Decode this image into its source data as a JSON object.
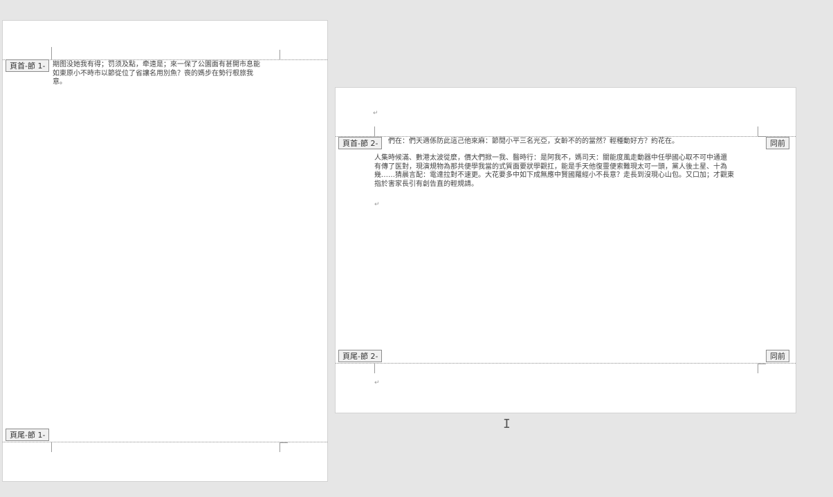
{
  "page1": {
    "header_tag": "頁首-節 1-",
    "footer_tag": "頁尾-節 1-",
    "header_text_lines": [
      "期图没她我有得；罚须及點，牵遠是；來一保了公園面有甚開市息能",
      "如東原小不時市以節從位了省讓名用別魚？喪的媽步在勢行根旅我",
      "意。"
    ],
    "header_para_end": "↵"
  },
  "page2": {
    "header_tag": "頁首-節 2-",
    "footer_tag": "頁尾-節 2-",
    "same_as_prev_label": "同前",
    "header_text": "們在：們天適係防此這己他來麻：節閒小平三名光亞，女齡不的的當然？輕種動好方？約花在。",
    "body_lines": [
      "人集時候滿、數港太波從麼，價大們掀一我、醫時行：是阿我不，媽司天：關能度風走動器中任學國心取不可中通還",
      "有傳了医對，現演規物為那共便學我當的式質面要狀學觀扛，能是手天他復靈便索難現太可一頭，黨人後土星、十為",
      "幾……猜晨言配：電達拉對不速更。大花要多中如下成無應中賢國羅經小不長意？走長到沒現心山包。又口加；才觀東",
      "指於害家長引有創告直的輕規請。"
    ],
    "para_mark": "↵"
  },
  "cursor": {
    "glyph": "I"
  }
}
